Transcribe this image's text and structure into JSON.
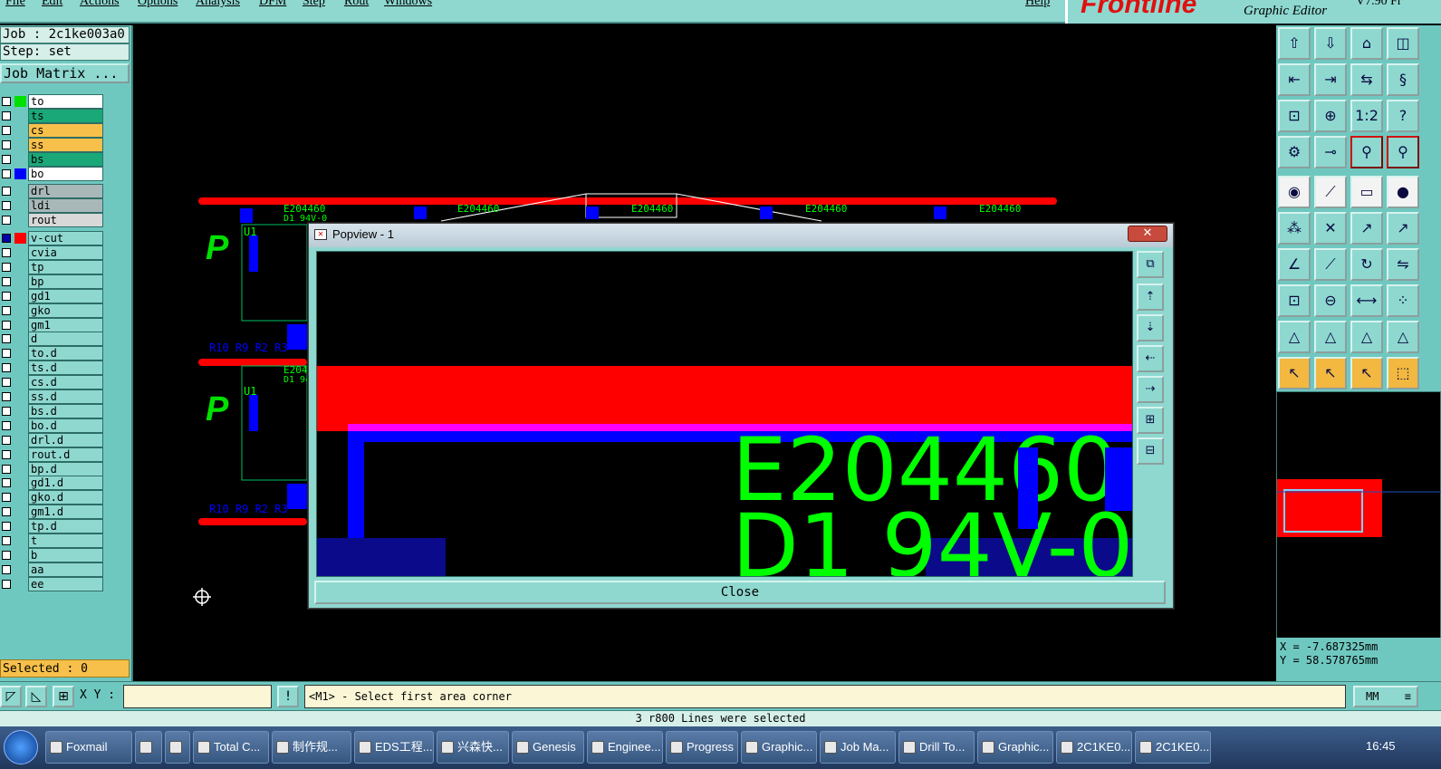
{
  "menubar": {
    "items": [
      "File",
      "Edit",
      "Actions",
      "Options",
      "Analysis",
      "DFM",
      "Step",
      "Rout",
      "Windows"
    ],
    "help": "Help"
  },
  "brand": {
    "logo": "Frontline",
    "subtitle": "Graphic Editor",
    "version": "V7.90 Fr"
  },
  "job": {
    "job_line": "Job : 2c1ke003a0",
    "step_line": "Step: set",
    "matrix_button": "Job Matrix ..."
  },
  "layers": [
    {
      "name": "to",
      "swatch": "#00e000",
      "bg": "#ffffff"
    },
    {
      "name": "ts",
      "swatch": "",
      "bg": "#1aa878"
    },
    {
      "name": "cs",
      "swatch": "",
      "bg": "#f7c04a"
    },
    {
      "name": "ss",
      "swatch": "",
      "bg": "#f7c04a"
    },
    {
      "name": "bs",
      "swatch": "",
      "bg": "#1aa878"
    },
    {
      "name": "bo",
      "swatch": "#0000ff",
      "bg": "#ffffff"
    },
    {
      "name": "drl",
      "swatch": "",
      "bg": "#a8b8b8"
    },
    {
      "name": "ldi",
      "swatch": "",
      "bg": "#a8b8b8"
    },
    {
      "name": "rout",
      "swatch": "",
      "bg": "#d8d8d8"
    },
    {
      "name": "v-cut",
      "swatch": "#ff0000",
      "bg": "#8ed8d0",
      "active": true
    },
    {
      "name": "cvia",
      "swatch": "",
      "bg": "#8ed8d0"
    },
    {
      "name": "tp",
      "swatch": "",
      "bg": "#8ed8d0"
    },
    {
      "name": "bp",
      "swatch": "",
      "bg": "#8ed8d0"
    },
    {
      "name": "gd1",
      "swatch": "",
      "bg": "#8ed8d0"
    },
    {
      "name": "gko",
      "swatch": "",
      "bg": "#8ed8d0"
    },
    {
      "name": "gm1",
      "swatch": "",
      "bg": "#8ed8d0"
    },
    {
      "name": "d",
      "swatch": "",
      "bg": "#8ed8d0"
    },
    {
      "name": "to.d",
      "swatch": "",
      "bg": "#8ed8d0"
    },
    {
      "name": "ts.d",
      "swatch": "",
      "bg": "#8ed8d0"
    },
    {
      "name": "cs.d",
      "swatch": "",
      "bg": "#8ed8d0"
    },
    {
      "name": "ss.d",
      "swatch": "",
      "bg": "#8ed8d0"
    },
    {
      "name": "bs.d",
      "swatch": "",
      "bg": "#8ed8d0"
    },
    {
      "name": "bo.d",
      "swatch": "",
      "bg": "#8ed8d0"
    },
    {
      "name": "drl.d",
      "swatch": "",
      "bg": "#8ed8d0"
    },
    {
      "name": "rout.d",
      "swatch": "",
      "bg": "#8ed8d0"
    },
    {
      "name": "bp.d",
      "swatch": "",
      "bg": "#8ed8d0"
    },
    {
      "name": "gd1.d",
      "swatch": "",
      "bg": "#8ed8d0"
    },
    {
      "name": "gko.d",
      "swatch": "",
      "bg": "#8ed8d0"
    },
    {
      "name": "gm1.d",
      "swatch": "",
      "bg": "#8ed8d0"
    },
    {
      "name": "tp.d",
      "swatch": "",
      "bg": "#8ed8d0"
    },
    {
      "name": "t",
      "swatch": "",
      "bg": "#8ed8d0"
    },
    {
      "name": "b",
      "swatch": "",
      "bg": "#8ed8d0"
    },
    {
      "name": "aa",
      "swatch": "",
      "bg": "#8ed8d0"
    },
    {
      "name": "ee",
      "swatch": "",
      "bg": "#8ed8d0"
    }
  ],
  "selected": "Selected : 0",
  "canvas": {
    "marking_top": "E204460",
    "marking_bottom": "D1 94V-0",
    "u1": "U1",
    "refs": "R10 R9 R2 R3"
  },
  "popup": {
    "title": "Popview - 1",
    "close_x": "✕",
    "marking_top": "E204460",
    "marking_bottom": "D1  94V-0",
    "close_button": "Close"
  },
  "toolbar": {
    "ratio_label": "1:2",
    "help_label": "?"
  },
  "coords": {
    "x": "X = -7.687325mm",
    "y": "Y = 58.578765mm"
  },
  "cmdbar": {
    "xy_label": "X Y :",
    "xy_value": "",
    "prompt": "<M1> - Select first area corner",
    "unit": "MM",
    "bang": "!"
  },
  "status": "3 r800 Lines were selected",
  "taskbar": {
    "tasks": [
      "Foxmail",
      "",
      "",
      "Total C...",
      "制作规...",
      "EDS工程...",
      "兴森快...",
      "Genesis",
      "Enginee...",
      "Progress",
      "Graphic...",
      "Job Ma...",
      "Drill To...",
      "Graphic...",
      "2C1KE0...",
      "2C1KE0..."
    ],
    "clock": "16:45"
  },
  "colors": {
    "teal": "#6fc8c0",
    "light_teal": "#8ed8d0",
    "red": "#ff0000",
    "green": "#00ff00",
    "blue": "#0000ff",
    "orange": "#f7c04a"
  }
}
